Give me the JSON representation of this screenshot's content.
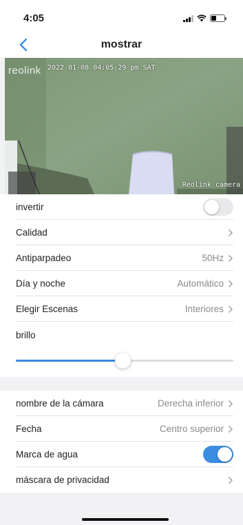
{
  "status_bar": {
    "time": "4:05"
  },
  "nav": {
    "title": "mostrar"
  },
  "camera": {
    "logo": "reolink",
    "timestamp": "2022-01-08 04:05:29 pm SAT",
    "label": "Reolink camera"
  },
  "settings": {
    "invert": {
      "label": "invertir",
      "on": false
    },
    "quality": {
      "label": "Calidad",
      "value": ""
    },
    "antiflicker": {
      "label": "Antiparpadeo",
      "value": "50Hz"
    },
    "day_night": {
      "label": "Día y noche",
      "value": "Automático"
    },
    "scenes": {
      "label": "Elegir Escenas",
      "value": "Interiores"
    },
    "brightness": {
      "label": "brillo",
      "level": 0.49
    }
  },
  "osd": {
    "camera_name": {
      "label": "nombre de la cámara",
      "value": "Derecha inferior"
    },
    "date": {
      "label": "Fecha",
      "value": "Centro superior"
    },
    "watermark": {
      "label": "Marca de agua",
      "on": true
    },
    "privacy_mask": {
      "label": "máscara de privacidad",
      "value": ""
    }
  },
  "colors": {
    "accent": "#3a8de0",
    "toggle_off": "#e9e9eb",
    "background": "#f2f2f4"
  }
}
